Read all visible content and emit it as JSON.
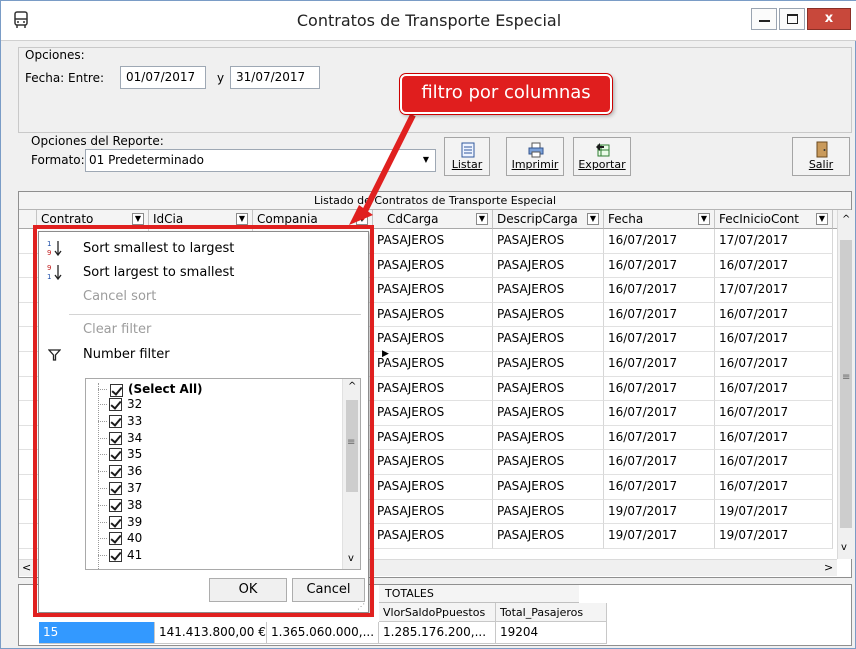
{
  "window": {
    "title": "Contratos de Transporte Especial",
    "minimize": "—",
    "maximize": "☐",
    "close": "x"
  },
  "options": {
    "group_label": "Opciones:",
    "date_label": "Fecha: Entre:",
    "date_from": "01/07/2017",
    "date_and": "y",
    "date_to": "31/07/2017"
  },
  "report": {
    "group_label": "Opciones del Reporte:",
    "format_label": "Formato:",
    "format_value": "01 Predeterminado"
  },
  "toolbar": {
    "listar": "Listar",
    "imprimir": "Imprimir",
    "exportar": "Exportar",
    "salir": "Salir"
  },
  "annotation": {
    "callout": "filtro por columnas"
  },
  "grid": {
    "title": "Listado de Contratos de Transporte Especial",
    "columns": [
      "Contrato",
      "IdCia",
      "Compania",
      "CdCarga",
      "DescripCarga",
      "Fecha",
      "FecInicioCont"
    ],
    "rows": [
      [
        "PASAJEROS",
        "PASAJEROS",
        "16/07/2017",
        "17/07/2017"
      ],
      [
        "PASAJEROS",
        "PASAJEROS",
        "16/07/2017",
        "16/07/2017"
      ],
      [
        "PASAJEROS",
        "PASAJEROS",
        "16/07/2017",
        "17/07/2017"
      ],
      [
        "PASAJEROS",
        "PASAJEROS",
        "16/07/2017",
        "16/07/2017"
      ],
      [
        "PASAJEROS",
        "PASAJEROS",
        "16/07/2017",
        "16/07/2017"
      ],
      [
        "PASAJEROS",
        "PASAJEROS",
        "16/07/2017",
        "16/07/2017"
      ],
      [
        "PASAJEROS",
        "PASAJEROS",
        "16/07/2017",
        "16/07/2017"
      ],
      [
        "PASAJEROS",
        "PASAJEROS",
        "16/07/2017",
        "16/07/2017"
      ],
      [
        "PASAJEROS",
        "PASAJEROS",
        "16/07/2017",
        "16/07/2017"
      ],
      [
        "PASAJEROS",
        "PASAJEROS",
        "16/07/2017",
        "16/07/2017"
      ],
      [
        "PASAJEROS",
        "PASAJEROS",
        "16/07/2017",
        "16/07/2017"
      ],
      [
        "PASAJEROS",
        "PASAJEROS",
        "19/07/2017",
        "19/07/2017"
      ],
      [
        "PASAJEROS",
        "PASAJEROS",
        "19/07/2017",
        "19/07/2017"
      ]
    ]
  },
  "filter_menu": {
    "sort_asc": "Sort smallest to largest",
    "sort_desc": "Sort largest to smallest",
    "cancel_sort": "Cancel sort",
    "clear_filter": "Clear filter",
    "number_filter": "Number filter",
    "select_all": "(Select All)",
    "values": [
      "32",
      "33",
      "34",
      "35",
      "36",
      "37",
      "38",
      "39",
      "40",
      "41"
    ],
    "ok": "OK",
    "cancel": "Cancel"
  },
  "totals": {
    "title": "TOTALES",
    "headers": [
      "VlorSaldoPpuestos",
      "Total_Pasajeros"
    ],
    "values": [
      "15",
      "141.413.800,00 €",
      "1.365.060.000,...",
      "1.285.176.200,...",
      "19204"
    ]
  },
  "colors": {
    "accent_red": "#e0201f",
    "selection_blue": "#3399ff"
  }
}
